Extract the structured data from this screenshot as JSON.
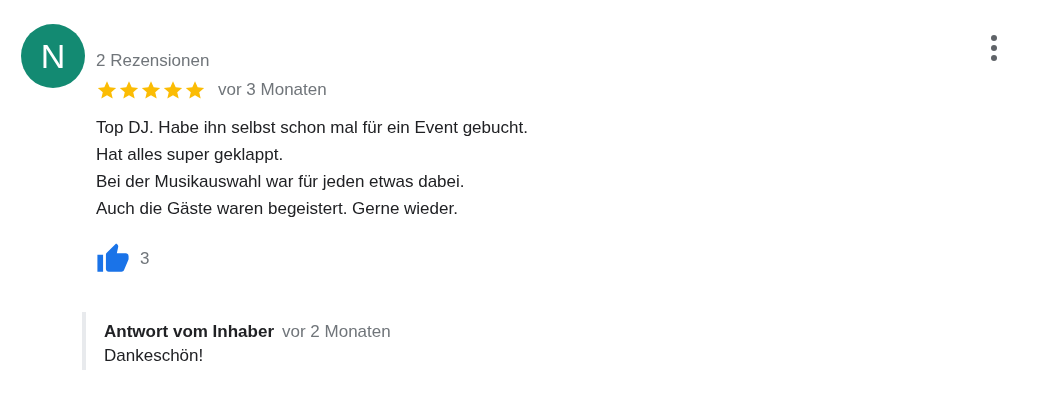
{
  "review": {
    "avatar_letter": "N",
    "reviewer_info": "2 Rezensionen",
    "stars": 5,
    "time": "vor 3 Monaten",
    "text_lines": [
      "Top DJ. Habe ihn selbst schon mal für ein Event gebucht.",
      "Hat alles super geklappt.",
      "Bei der Musikauswahl war für jeden etwas dabei.",
      "Auch die Gäste waren begeistert. Gerne wieder."
    ],
    "likes": "3"
  },
  "owner_reply": {
    "title": "Antwort vom Inhaber",
    "time": "vor 2 Monaten",
    "text": "Dankeschön!"
  }
}
